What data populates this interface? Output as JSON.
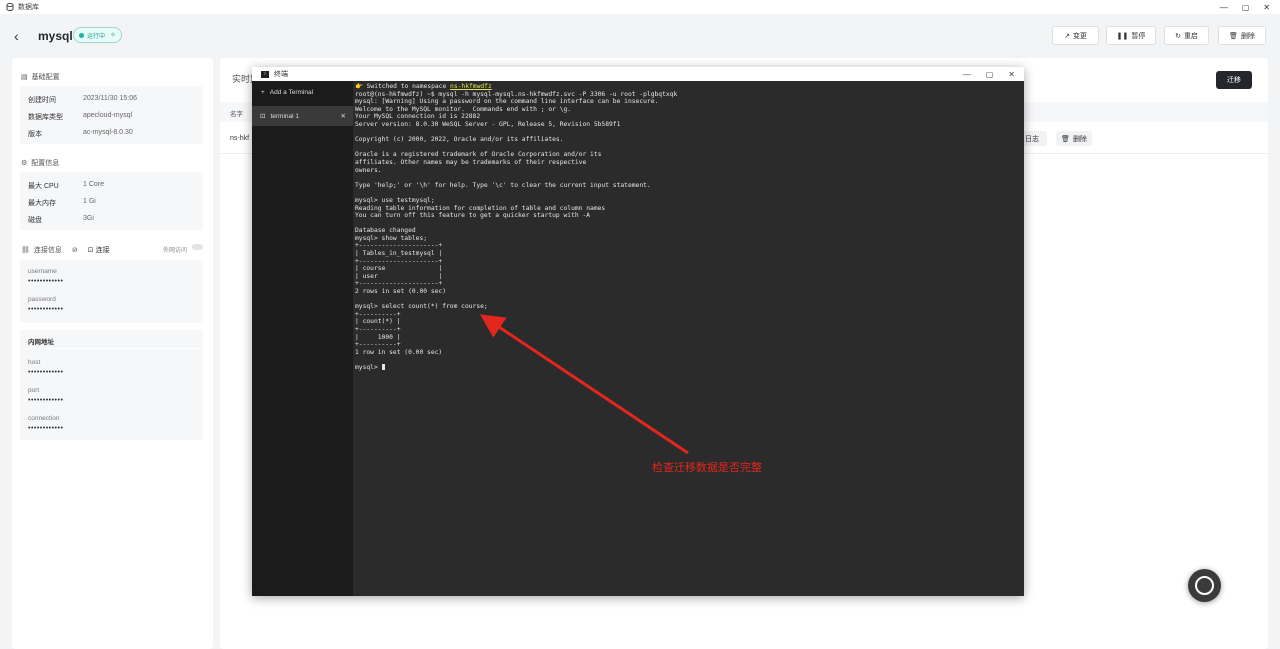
{
  "window": {
    "title": "数据库"
  },
  "header": {
    "back_icon": "chevron-left-icon",
    "app_name": "mysql",
    "status": "运行中",
    "buttons": {
      "change": "变更",
      "pause": "暂停",
      "restart": "重启",
      "delete": "删除"
    }
  },
  "sidebar": {
    "basic": {
      "title": "基础配置",
      "rows": [
        {
          "label": "创建时间",
          "value": "2023/11/30 15:06"
        },
        {
          "label": "数据库类型",
          "value": "apecloud-mysql"
        },
        {
          "label": "版本",
          "value": "ac-mysql-8.0.30"
        }
      ]
    },
    "config": {
      "title": "配置信息",
      "rows": [
        {
          "label": "最大 CPU",
          "value": "1 Core"
        },
        {
          "label": "最大内存",
          "value": "1 Gi"
        },
        {
          "label": "磁盘",
          "value": "3Gi"
        }
      ]
    },
    "connection": {
      "title": "连接信息",
      "connect_label": "连接",
      "external_label": "外网访问",
      "username_label": "username",
      "username_value": "••••••••••••",
      "password_label": "password",
      "password_value": "••••••••••••"
    },
    "internal": {
      "title": "内网地址",
      "host_label": "host",
      "host_value": "••••••••••••",
      "port_label": "port",
      "port_value": "••••••••••••",
      "conn_label": "connection",
      "conn_value": "••••••••••••"
    }
  },
  "main": {
    "tab": "实时监",
    "migrate_button": "迁移",
    "column_name": "名字",
    "row_name": "ns-hkf",
    "log_button": "日志",
    "delete_button": "删除"
  },
  "terminal": {
    "title": "终端",
    "add_label": "Add a Terminal",
    "tab_label": "terminal 1",
    "namespace_prefix": "👉 Switched to namespace ",
    "namespace": "ns-hkfmwdfz",
    "output": "root@(ns-hkfmwdfz) ~$ mysql -h mysql-mysql.ns-hkfmwdfz.svc -P 3306 -u root -plgbqtxqk\nmysql: [Warning] Using a password on the command line interface can be insecure.\nWelcome to the MySQL monitor.  Commands end with ; or \\g.\nYour MySQL connection id is 22882\nServer version: 8.0.30 WeSQL Server - GPL, Release 5, Revision 5b589f1\n\nCopyright (c) 2000, 2022, Oracle and/or its affiliates.\n\nOracle is a registered trademark of Oracle Corporation and/or its\naffiliates. Other names may be trademarks of their respective\nowners.\n\nType 'help;' or '\\h' for help. Type '\\c' to clear the current input statement.\n\nmysql> use testmysql;\nReading table information for completion of table and column names\nYou can turn off this feature to get a quicker startup with -A\n\nDatabase changed\nmysql> show tables;\n+---------------------+\n| Tables_in_testmysql |\n+---------------------+\n| course              |\n| user                |\n+---------------------+\n2 rows in set (0.00 sec)\n\nmysql> select count(*) from course;\n+----------+\n| count(*) |\n+----------+\n|     1000 |\n+----------+\n1 row in set (0.00 sec)\n\nmysql> ",
    "annotation": "检查迁移数据是否完整"
  },
  "colors": {
    "accent_teal": "#1ab3a3",
    "annotation_red": "#e3261d",
    "terminal_bg": "#2b2b2b",
    "primary_dark": "#24282c"
  }
}
